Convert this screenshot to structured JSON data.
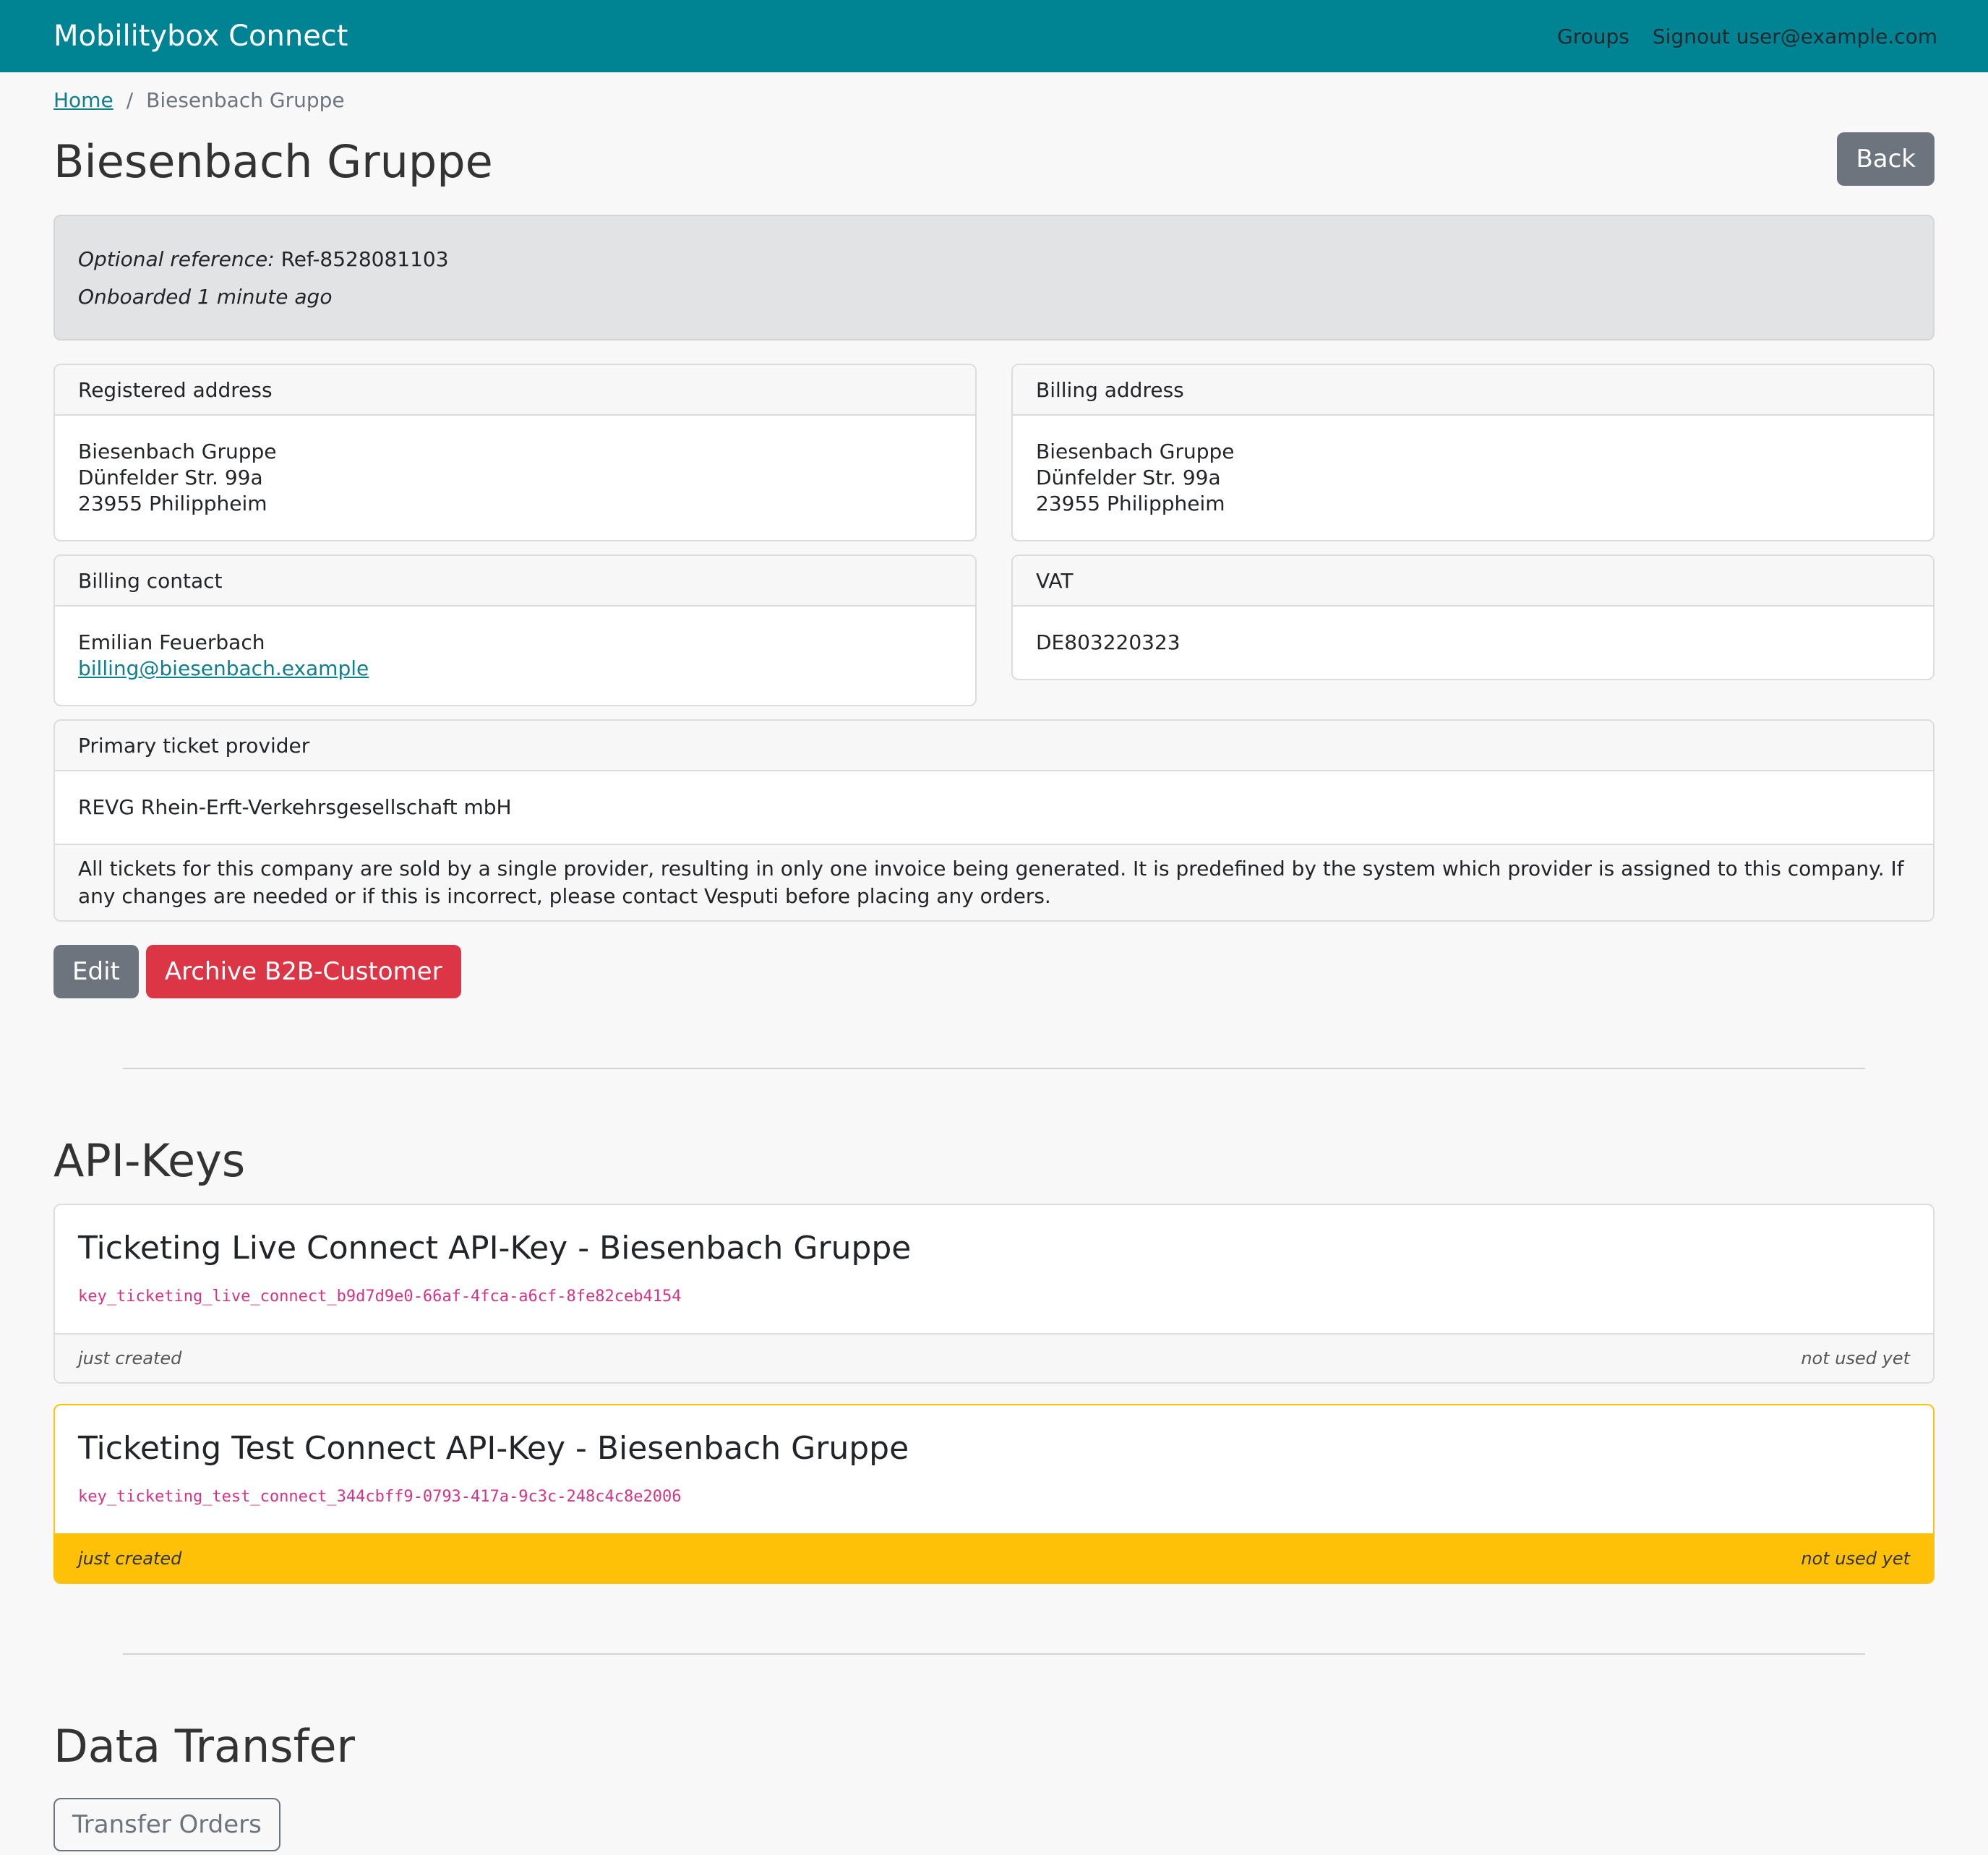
{
  "navbar": {
    "brand": "Mobilitybox Connect",
    "groups": "Groups",
    "signout": "Signout user@example.com"
  },
  "breadcrumb": {
    "home": "Home",
    "separator": "/",
    "current": "Biesenbach Gruppe"
  },
  "page": {
    "title": "Biesenbach Gruppe",
    "back_label": "Back"
  },
  "info": {
    "ref_label": "Optional reference:",
    "ref_value": "Ref-8528081103",
    "onboarded": "Onboarded 1 minute ago"
  },
  "registered_address": {
    "header": "Registered address",
    "name": "Biesenbach Gruppe",
    "street": "Dünfelder Str. 99a",
    "city": "23955 Philippheim"
  },
  "billing_address": {
    "header": "Billing address",
    "name": "Biesenbach Gruppe",
    "street": "Dünfelder Str. 99a",
    "city": "23955 Philippheim"
  },
  "billing_contact": {
    "header": "Billing contact",
    "name": "Emilian Feuerbach",
    "email": "billing@biesenbach.example"
  },
  "vat": {
    "header": "VAT",
    "value": "DE803220323"
  },
  "ticket_provider": {
    "header": "Primary ticket provider",
    "name": "REVG Rhein-Erft-Verkehrsgesellschaft mbH",
    "note": "All tickets for this company are sold by a single provider, resulting in only one invoice being generated. It is predefined by the system which provider is assigned to this company. If any changes are needed or if this is incorrect, please contact Vesputi before placing any orders."
  },
  "actions": {
    "edit": "Edit",
    "archive": "Archive B2B-Customer"
  },
  "api_keys": {
    "title": "API-Keys",
    "items": [
      {
        "title": "Ticketing Live Connect API-Key - Biesenbach Gruppe",
        "key": "key_ticketing_live_connect_b9d7d9e0-66af-4fca-a6cf-8fe82ceb4154",
        "created": "just created",
        "used": "not used yet"
      },
      {
        "title": "Ticketing Test Connect API-Key - Biesenbach Gruppe",
        "key": "key_ticketing_test_connect_344cbff9-0793-417a-9c3c-248c4c8e2006",
        "created": "just created",
        "used": "not used yet"
      }
    ]
  },
  "data_transfer": {
    "title": "Data Transfer",
    "transfer_label": "Transfer Orders"
  },
  "colors": {
    "navbar": "#008494",
    "danger": "#dc3545",
    "secondary": "#6c757d",
    "warning": "#ffc107",
    "code": "#d63384"
  }
}
